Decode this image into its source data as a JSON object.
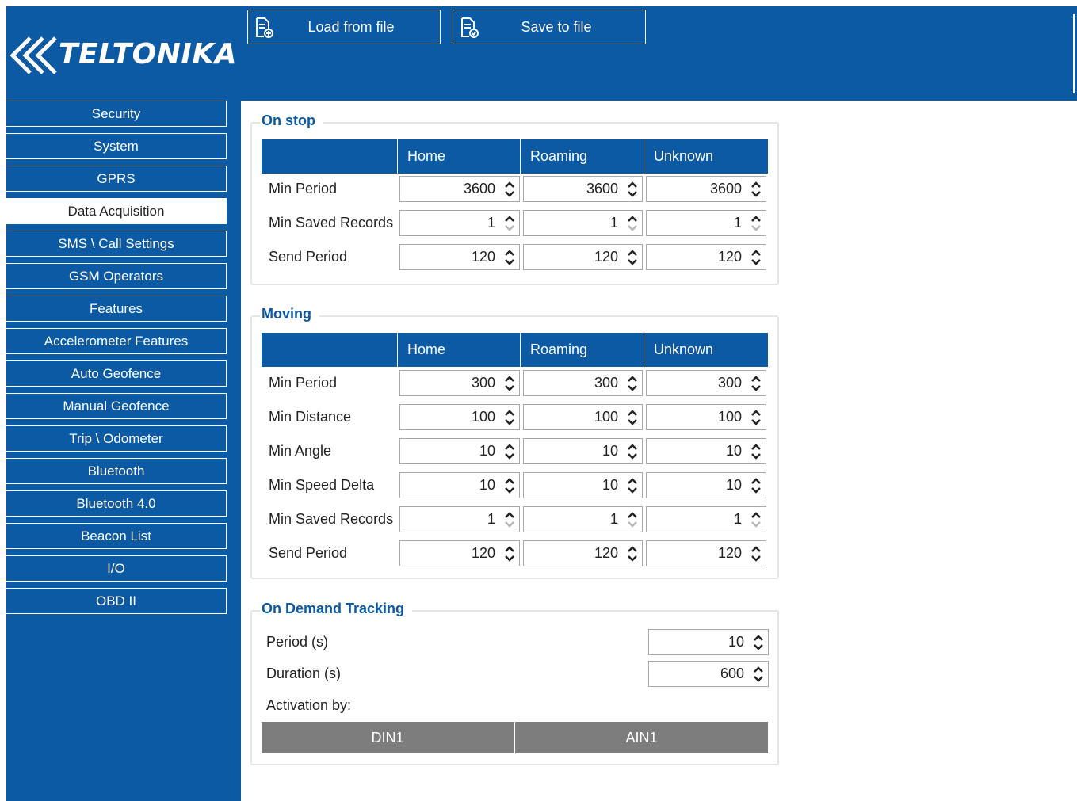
{
  "brand": {
    "logo_text": "TELTONIKA"
  },
  "toolbar": {
    "load_label": "Load from file",
    "save_label": "Save to file"
  },
  "sidebar": {
    "items": [
      {
        "label": "Security"
      },
      {
        "label": "System"
      },
      {
        "label": "GPRS"
      },
      {
        "label": "Data Acquisition",
        "active": true
      },
      {
        "label": "SMS \\ Call Settings"
      },
      {
        "label": "GSM Operators"
      },
      {
        "label": "Features"
      },
      {
        "label": "Accelerometer Features"
      },
      {
        "label": "Auto Geofence"
      },
      {
        "label": "Manual Geofence"
      },
      {
        "label": "Trip \\ Odometer"
      },
      {
        "label": "Bluetooth"
      },
      {
        "label": "Bluetooth 4.0"
      },
      {
        "label": "Beacon List"
      },
      {
        "label": "I/O"
      },
      {
        "label": "OBD II"
      }
    ]
  },
  "columns": [
    "Home",
    "Roaming",
    "Unknown"
  ],
  "on_stop": {
    "title": "On stop",
    "rows": [
      {
        "label": "Min Period",
        "values": [
          "3600",
          "3600",
          "3600"
        ]
      },
      {
        "label": "Min Saved Records",
        "values": [
          "1",
          "1",
          "1"
        ]
      },
      {
        "label": "Send Period",
        "values": [
          "120",
          "120",
          "120"
        ]
      }
    ]
  },
  "moving": {
    "title": "Moving",
    "rows": [
      {
        "label": "Min Period",
        "values": [
          "300",
          "300",
          "300"
        ]
      },
      {
        "label": "Min Distance",
        "values": [
          "100",
          "100",
          "100"
        ]
      },
      {
        "label": "Min Angle",
        "values": [
          "10",
          "10",
          "10"
        ]
      },
      {
        "label": "Min Speed Delta",
        "values": [
          "10",
          "10",
          "10"
        ]
      },
      {
        "label": "Min Saved Records",
        "values": [
          "1",
          "1",
          "1"
        ]
      },
      {
        "label": "Send Period",
        "values": [
          "120",
          "120",
          "120"
        ]
      }
    ]
  },
  "on_demand": {
    "title": "On Demand Tracking",
    "period_label": "Period   (s)",
    "period_value": "10",
    "duration_label": "Duration   (s)",
    "duration_value": "600",
    "activation_label": "Activation by:",
    "din_label": "DIN1",
    "ain_label": "AIN1"
  },
  "colors": {
    "brand_blue": "#0b5aa3",
    "disabled_gray": "#7d7d7d"
  }
}
